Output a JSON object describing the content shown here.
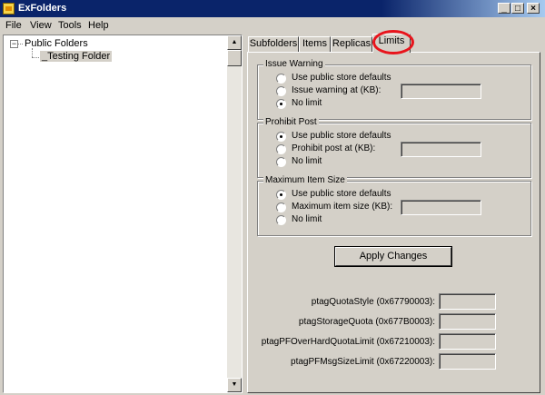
{
  "window": {
    "title": "ExFolders",
    "controls": {
      "minimize": "_",
      "maximize": "□",
      "close": "×"
    }
  },
  "menu": [
    "File",
    "View",
    "Tools",
    "Help"
  ],
  "tree": {
    "expander": "−",
    "root": "Public Folders",
    "children": [
      "_Testing Folder"
    ]
  },
  "tabs": [
    "Subfolders",
    "Items",
    "Replicas",
    "Limits"
  ],
  "active_tab": "Limits",
  "groups": {
    "issue_warning": {
      "title": "Issue Warning",
      "options": [
        "Use public store defaults",
        "Issue warning at (KB):",
        "No limit"
      ],
      "selected": "No limit",
      "value": ""
    },
    "prohibit_post": {
      "title": "Prohibit Post",
      "options": [
        "Use public store defaults",
        "Prohibit post at (KB):",
        "No limit"
      ],
      "selected": "Use public store defaults",
      "value": ""
    },
    "max_item_size": {
      "title": "Maximum Item Size",
      "options": [
        "Use public store defaults",
        "Maximum item size (KB):",
        "No limit"
      ],
      "selected": "Use public store defaults",
      "value": ""
    }
  },
  "apply_button": "Apply Changes",
  "properties": [
    {
      "label": "ptagQuotaStyle (0x67790003):",
      "value": ""
    },
    {
      "label": "ptagStorageQuota (0x677B0003):",
      "value": ""
    },
    {
      "label": "ptagPFOverHardQuotaLimit (0x67210003):",
      "value": ""
    },
    {
      "label": "ptagPFMsgSizeLimit (0x67220003):",
      "value": ""
    }
  ],
  "colors": {
    "annotation_circle": "#e8141c",
    "titlebar": "#0a246a",
    "face": "#d4d0c8"
  },
  "icons": {
    "app": "folder-app-icon",
    "scroll_up": "arrow-up-icon",
    "scroll_down": "arrow-down-icon"
  }
}
